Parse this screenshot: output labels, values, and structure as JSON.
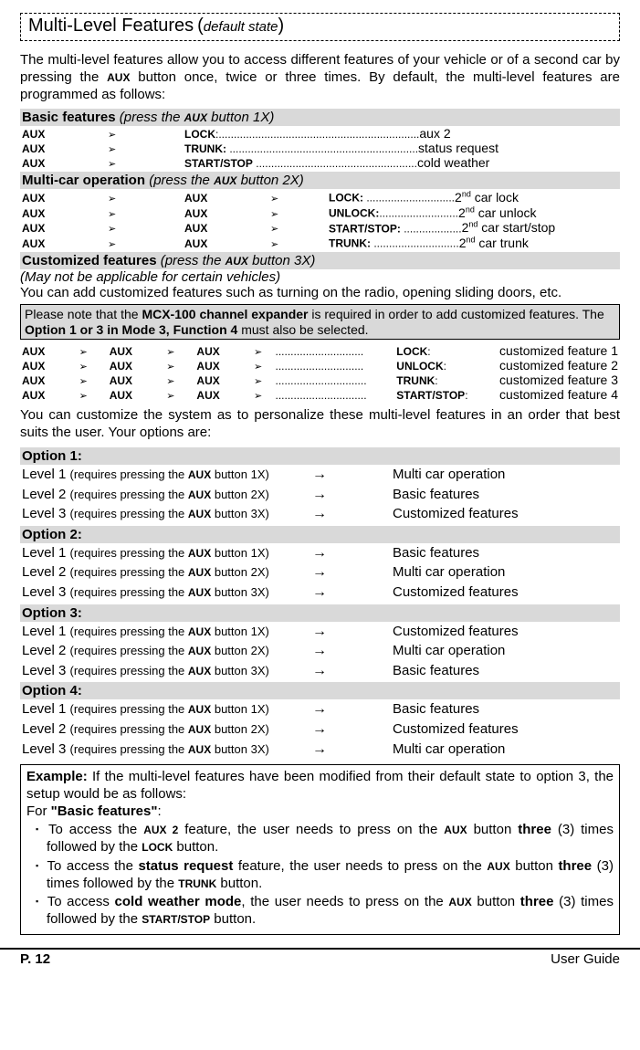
{
  "title": {
    "main": "Multi-Level Features",
    "paren_open": "(",
    "sub": "default state",
    "paren_close": ")"
  },
  "intro": {
    "t1": "The multi-level features allow you to access different features of your vehicle or of a second car by pressing the ",
    "aux": "AUX",
    "t2": " button once, twice or three times. By default, the multi-level features are programmed as follows:"
  },
  "sec_basic": {
    "title": "Basic features",
    "inst": "press the ",
    "aux": "AUX",
    "inst2": " button 1X"
  },
  "basic_rows": [
    {
      "c1": "AUX",
      "c2": "➢",
      "c3": "LOCK",
      "d": ":..................................................................",
      "r": "aux 2"
    },
    {
      "c1": "AUX",
      "c2": "➢",
      "c3": "TRUNK:",
      "d": " ..............................................................",
      "r": "status request"
    },
    {
      "c1": "AUX",
      "c2": "➢",
      "c3": "START/STOP",
      "d": " .....................................................",
      "r": "cold weather"
    }
  ],
  "sec_multi": {
    "title": "Multi-car operation",
    "inst": "press the ",
    "aux": "AUX",
    "inst2": " button 2X"
  },
  "multi_rows": [
    {
      "c1": "AUX",
      "c2": "➢",
      "c3": "AUX",
      "c4": "➢",
      "c5": "LOCK:",
      "d": " .............................",
      "r1": "2",
      "sup": "nd",
      "r2": " car lock"
    },
    {
      "c1": "AUX",
      "c2": "➢",
      "c3": "AUX",
      "c4": "➢",
      "c5": "UNLOCK:",
      "d": "..........................",
      "r1": "2",
      "sup": "nd",
      "r2": " car unlock"
    },
    {
      "c1": "AUX",
      "c2": "➢",
      "c3": "AUX",
      "c4": "➢",
      "c5": "START/STOP:",
      "d": " ...................",
      "r1": "2",
      "sup": "nd",
      "r2": " car start/stop"
    },
    {
      "c1": "AUX",
      "c2": "➢",
      "c3": "AUX",
      "c4": "➢",
      "c5": "TRUNK:",
      "d": " ............................",
      "r1": "2",
      "sup": "nd",
      "r2": " car trunk"
    }
  ],
  "sec_cust": {
    "title": "Customized features",
    "inst": "press the ",
    "aux": "AUX",
    "inst2": " button 3X"
  },
  "cust_note1": "(May not be applicable for certain vehicles)",
  "cust_note2": "You can add customized features such as turning on the radio, opening sliding doors, etc.",
  "mcx_note": {
    "t1": "Please note that the ",
    "b1": "MCX-100 channel expander",
    "t2": " is required in order to add customized features. The ",
    "b2": "Option 1 or 3 in Mode 3, Function 4",
    "t3": " must also be selected."
  },
  "cust_rows": [
    {
      "c1": "AUX",
      "c2": "➢",
      "c3": "AUX",
      "c4": "➢",
      "c5": "AUX",
      "c6": "➢",
      "d": ".............................",
      "c7": "LOCK",
      "col": ":",
      "r": "customized feature 1"
    },
    {
      "c1": "AUX",
      "c2": "➢",
      "c3": "AUX",
      "c4": "➢",
      "c5": "AUX",
      "c6": "➢",
      "d": ".............................",
      "c7": "UNLOCK",
      "col": ":",
      "r": "customized feature 2"
    },
    {
      "c1": "AUX",
      "c2": "➢",
      "c3": "AUX",
      "c4": "➢",
      "c5": "AUX",
      "c6": "➢",
      "d": "..............................",
      "c7": "TRUNK",
      "col": ":",
      "r": "customized feature 3"
    },
    {
      "c1": "AUX",
      "c2": "➢",
      "c3": "AUX",
      "c4": "➢",
      "c5": "AUX",
      "c6": "➢",
      "d": "..............................",
      "c7": "START/STOP",
      "col": ":",
      "r": "customized feature 4"
    }
  ],
  "custom_para": "You can customize the system as to personalize these multi-level features in an order that best suits the user.  Your options are:",
  "options": [
    {
      "hdr": "Option 1:",
      "rows": [
        {
          "l": "Level 1",
          "r": "requires pressing the ",
          "aux": "AUX",
          "b": " button 1X",
          "a": "→",
          "res": "Multi car operation"
        },
        {
          "l": "Level 2",
          "r": "requires pressing the ",
          "aux": "AUX",
          "b": " button 2X",
          "a": "→",
          "res": "Basic features"
        },
        {
          "l": "Level 3",
          "r": "requires pressing the ",
          "aux": "AUX",
          "b": " button 3X",
          "a": "→",
          "res": "Customized features"
        }
      ]
    },
    {
      "hdr": "Option 2:",
      "rows": [
        {
          "l": "Level 1",
          "r": "requires pressing the ",
          "aux": "AUX",
          "b": " button 1X",
          "a": "→",
          "res": "Basic features"
        },
        {
          "l": "Level 2",
          "r": "requires pressing the ",
          "aux": "AUX",
          "b": " button 2X",
          "a": "→",
          "res": "Multi car operation"
        },
        {
          "l": "Level 3",
          "r": "requires pressing the ",
          "aux": "AUX",
          "b": " button 3X",
          "a": "→",
          "res": "Customized features"
        }
      ]
    },
    {
      "hdr": "Option 3:",
      "rows": [
        {
          "l": "Level 1",
          "r": "requires pressing the ",
          "aux": "AUX",
          "b": " button 1X",
          "a": "→",
          "res": "Customized features"
        },
        {
          "l": "Level 2",
          "r": "requires pressing the ",
          "aux": "AUX",
          "b": " button 2X",
          "a": "→",
          "res": "Multi car operation"
        },
        {
          "l": "Level 3",
          "r": "requires pressing the ",
          "aux": "AUX",
          "b": " button 3X",
          "a": "→",
          "res": "Basic features"
        }
      ]
    },
    {
      "hdr": "Option 4:",
      "rows": [
        {
          "l": "Level 1",
          "r": "requires pressing the ",
          "aux": "AUX",
          "b": " button 1X",
          "a": "→",
          "res": "Basic features"
        },
        {
          "l": "Level 2",
          "r": "requires pressing the ",
          "aux": "AUX",
          "b": " button 2X",
          "a": "→",
          "res": "Customized features"
        },
        {
          "l": "Level 3",
          "r": "requires pressing the ",
          "aux": "AUX",
          "b": " button 3X",
          "a": "→",
          "res": "Multi car operation"
        }
      ]
    }
  ],
  "example": {
    "pre": "Example:",
    "t1": " If the multi-level features have been modified from their default state to option 3, the setup would be as follows:",
    "for": "For ",
    "bf": "\"Basic features\"",
    "col": ":",
    "li1": {
      "t1": "To access the ",
      "b1": "AUX 2",
      "t2": " feature, the user needs to press on the ",
      "b2": "AUX",
      "t3": " button ",
      "b3": "three",
      "t4": " (3) times followed by the ",
      "b4": "LOCK",
      "t5": " button."
    },
    "li2": {
      "t1": "To access the ",
      "b1": "status request",
      "t2": " feature, the user needs to press on the ",
      "b2": "AUX",
      "t3": " button ",
      "b3": "three",
      "t4": " (3) times followed by the ",
      "b4": "TRUNK",
      "t5": " button."
    },
    "li3": {
      "t1": "To access ",
      "b1": "cold weather mode",
      "t2": ", the user needs to press on the ",
      "b2": "AUX",
      "t3": " button ",
      "b3": "three",
      "t4": " (3) times followed by the ",
      "b4": "START/STOP",
      "t5": " button."
    }
  },
  "footer": {
    "left": "P. 12",
    "right": "User Guide"
  }
}
